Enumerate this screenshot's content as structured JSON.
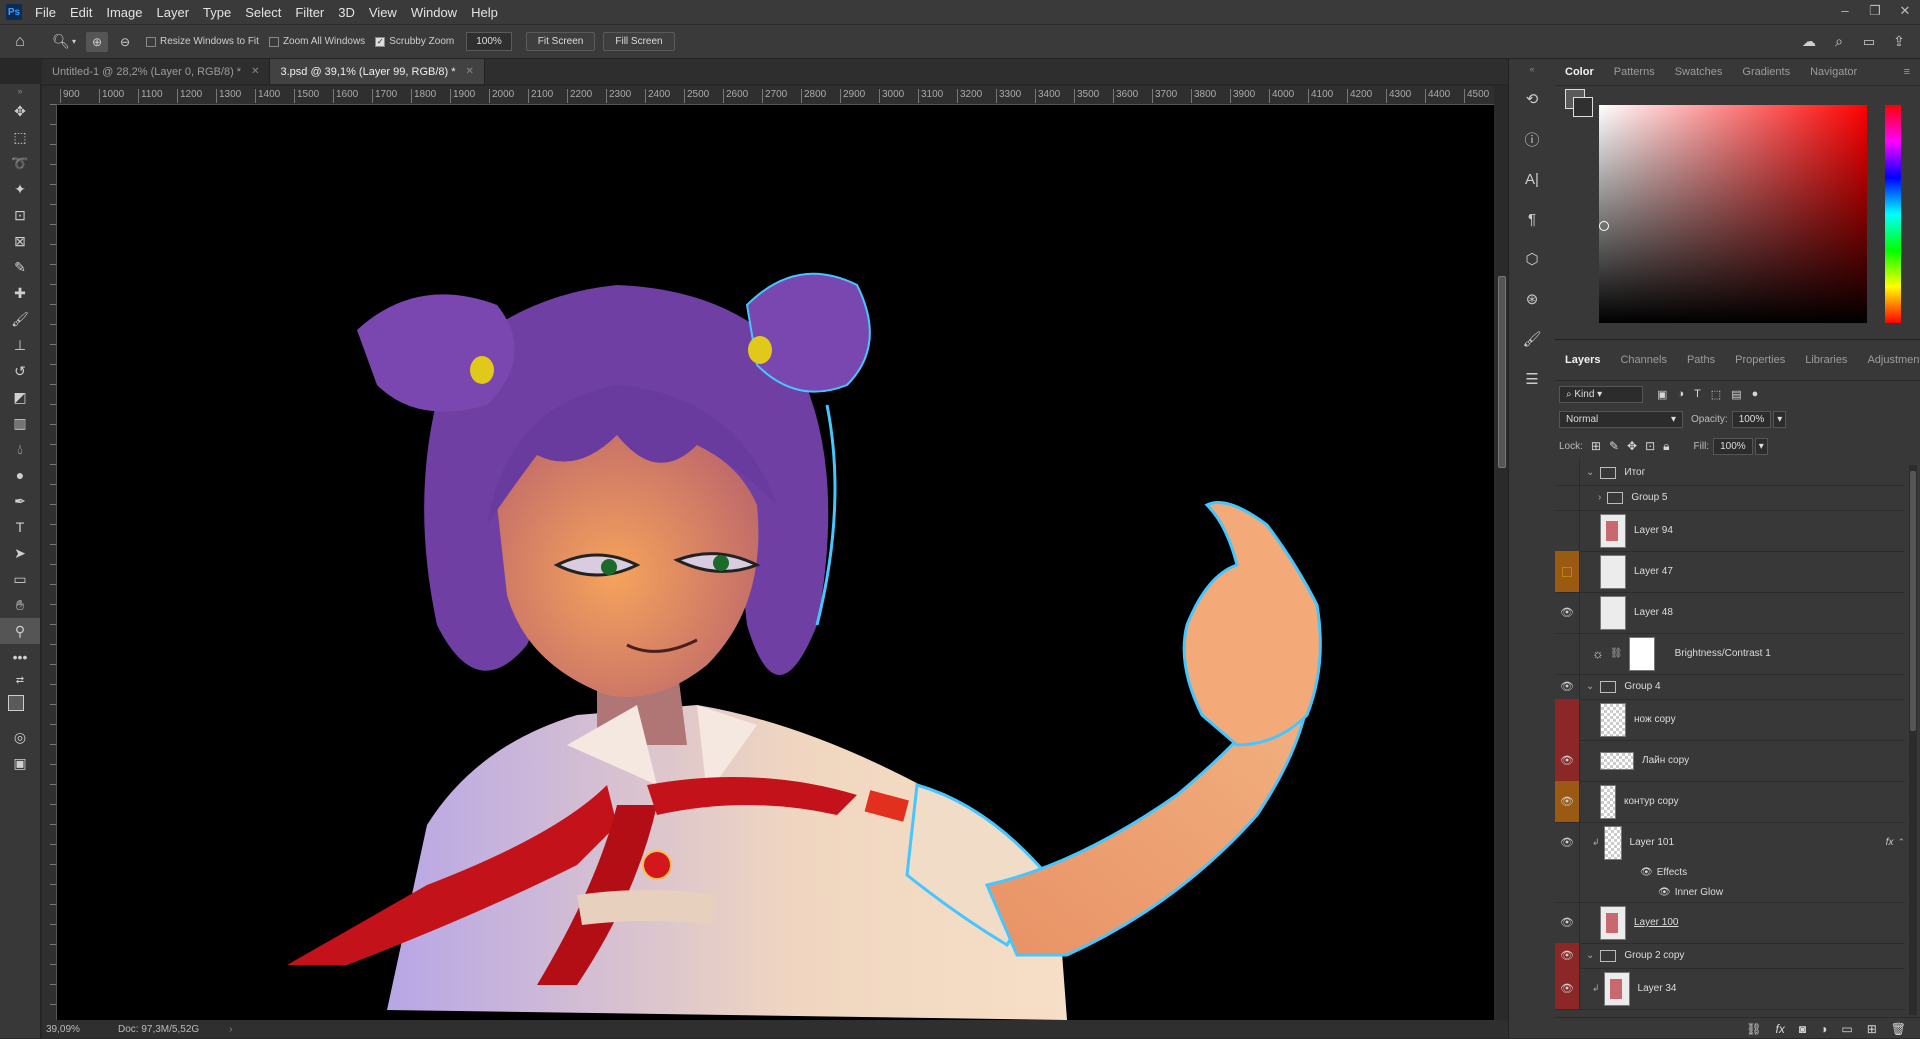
{
  "app": {
    "logo": "Ps"
  },
  "menus": [
    "File",
    "Edit",
    "Image",
    "Layer",
    "Type",
    "Select",
    "Filter",
    "3D",
    "View",
    "Window",
    "Help"
  ],
  "window_controls": {
    "minimize": "–",
    "restore": "❐",
    "close": "✕"
  },
  "options": {
    "resize_windows": "Resize Windows to Fit",
    "zoom_all": "Zoom All Windows",
    "scrubby_zoom": "Scrubby Zoom",
    "zoom_value": "100%",
    "fit_screen": "Fit Screen",
    "fill_screen": "Fill Screen"
  },
  "tabs": [
    {
      "label": "Untitled-1 @ 28,2% (Layer 0, RGB/8) *",
      "active": false
    },
    {
      "label": "3.psd @ 39,1% (Layer 99, RGB/8) *",
      "active": true
    }
  ],
  "ruler": [
    "900",
    "1000",
    "1100",
    "1200",
    "1300",
    "1400",
    "1500",
    "1600",
    "1700",
    "1800",
    "1900",
    "2000",
    "2100",
    "2200",
    "2300",
    "2400",
    "2500",
    "2600",
    "2700",
    "2800",
    "2900",
    "3000",
    "3100",
    "3200",
    "3300",
    "3400",
    "3500",
    "3600",
    "3700",
    "3800",
    "3900",
    "4000",
    "4100",
    "4200",
    "4300",
    "4400",
    "4500"
  ],
  "status": {
    "zoom": "39,09%",
    "doc": "Doc: 97,3M/5,52G"
  },
  "color_panel": {
    "tabs": [
      "Color",
      "Patterns",
      "Swatches",
      "Gradients",
      "Navigator"
    ]
  },
  "layers_panel": {
    "tabs": [
      "Layers",
      "Channels",
      "Paths",
      "Properties",
      "Libraries",
      "Adjustments"
    ],
    "filter_kind": "Kind",
    "blend_mode": "Normal",
    "opacity_label": "Opacity:",
    "opacity_value": "100%",
    "lock_label": "Lock:",
    "fill_label": "Fill:",
    "fill_value": "100%",
    "layers": [
      {
        "name": "Итог",
        "kind": "group",
        "visible": false
      },
      {
        "name": "Group 5",
        "kind": "group",
        "visible": false
      },
      {
        "name": "Layer 94",
        "kind": "layer",
        "visible": false
      },
      {
        "name": "Layer 47",
        "kind": "layer",
        "visible": false,
        "tag": "orange"
      },
      {
        "name": "Layer 48",
        "kind": "layer",
        "visible": true
      },
      {
        "name": "Brightness/Contrast 1",
        "kind": "adjustment",
        "visible": false
      },
      {
        "name": "Group 4",
        "kind": "group",
        "visible": true
      },
      {
        "name": "нож copy",
        "kind": "layer",
        "visible": false,
        "tag": "red"
      },
      {
        "name": "Лайн copy",
        "kind": "layer",
        "visible": true,
        "tag": "red"
      },
      {
        "name": "контур copy",
        "kind": "layer",
        "visible": true,
        "tag": "orange"
      },
      {
        "name": "Layer 101",
        "kind": "layer",
        "visible": true,
        "fx": "fx"
      },
      {
        "name": "Effects",
        "kind": "effect",
        "visible": true
      },
      {
        "name": "Inner Glow",
        "kind": "effect",
        "visible": true
      },
      {
        "name": "Layer 100",
        "kind": "layer",
        "visible": true
      },
      {
        "name": "Group 2 copy",
        "kind": "group",
        "visible": true,
        "tag": "red"
      },
      {
        "name": "Layer 34",
        "kind": "layer",
        "visible": true,
        "tag": "red"
      }
    ]
  }
}
